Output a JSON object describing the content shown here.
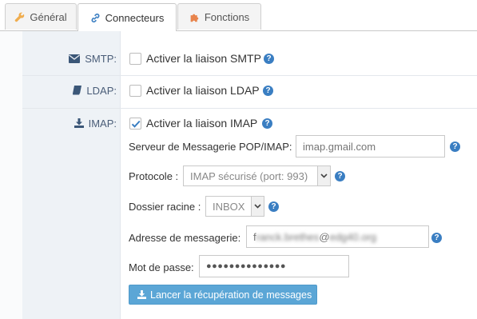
{
  "tabs": [
    {
      "label": "Général",
      "icon": "wrench-icon",
      "active": false
    },
    {
      "label": "Connecteurs",
      "icon": "link-icon",
      "active": true
    },
    {
      "label": "Fonctions",
      "icon": "puzzle-icon",
      "active": false
    }
  ],
  "rows": {
    "smtp": {
      "label": "SMTP:",
      "icon": "envelope-icon",
      "checkbox_label": "Activer la liaison SMTP",
      "checked": false
    },
    "ldap": {
      "label": "LDAP:",
      "icon": "book-icon",
      "checkbox_label": "Activer la liaison LDAP",
      "checked": false
    },
    "imap": {
      "label": "IMAP:",
      "icon": "download-icon",
      "checkbox_label": "Activer la liaison IMAP",
      "checked": true
    }
  },
  "imap_form": {
    "server_label": "Serveur de Messagerie POP/IMAP:",
    "server_placeholder": "imap.gmail.com",
    "protocol_label": "Protocole :",
    "protocol_value": "IMAP sécurisé (port: 993)",
    "folder_label": "Dossier racine :",
    "folder_value": "INBOX",
    "email_label": "Adresse de messagerie:",
    "email_value_prefix": "f",
    "email_value_blurred": "ranck.brethes",
    "email_value_at": "@",
    "email_value_domain_blurred": "edg40.org",
    "password_label": "Mot de passe:",
    "password_value": "●●●●●●●●●●●●●●",
    "fetch_button_label": "Lancer la récupération de messages",
    "help_glyph": "?"
  },
  "colors": {
    "accent_blue": "#3a7ec2",
    "button_blue": "#5ba6d6",
    "label_column_bg": "#eef2f6",
    "wrench_orange": "#f0ad4e",
    "puzzle_orange": "#e8844c"
  }
}
